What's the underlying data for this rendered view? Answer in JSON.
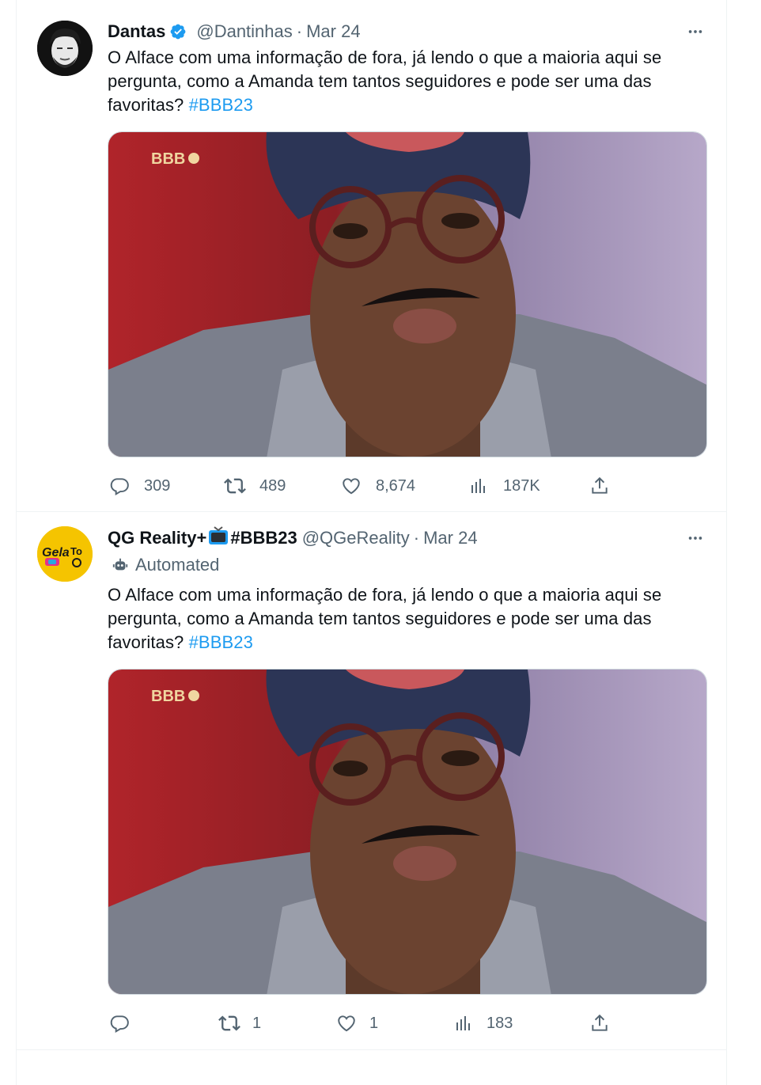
{
  "tweets": [
    {
      "author_name": "Dantas",
      "handle": "@Dantinhas",
      "separator": "·",
      "date": "Mar 24",
      "verified": true,
      "text_main": "O Alface com uma informação de fora, já lendo o que a maioria aqui se pergunta, como a Amanda tem tantos seguidores e pode ser uma das favoritas? ",
      "hashtag": "#BBB23",
      "media_watermark": "BBB",
      "stats": {
        "replies": "309",
        "retweets": "489",
        "likes": "8,674",
        "views": "187K"
      }
    },
    {
      "author_name": "QG Reality+",
      "author_name_suffix": "#BBB23",
      "handle": "@QGeReality",
      "separator": "·",
      "date": "Mar 24",
      "automated_label": "Automated",
      "text_main": "O Alface com uma informação de fora, já lendo o que a maioria aqui se pergunta, como a Amanda tem tantos seguidores e pode ser uma das favoritas? ",
      "hashtag": "#BBB23",
      "media_watermark": "BBB",
      "stats": {
        "replies": "",
        "retweets": "1",
        "likes": "1",
        "views": "183"
      }
    }
  ],
  "icons": {
    "more": "more-icon",
    "reply": "reply-icon",
    "retweet": "retweet-icon",
    "like": "heart-icon",
    "views": "views-icon",
    "share": "share-icon",
    "verified": "verified-badge-icon",
    "bot": "bot-icon",
    "tv": "tv-emoji-icon"
  },
  "colors": {
    "accent": "#1d9bf0",
    "muted": "#536471",
    "text": "#0f1419"
  }
}
